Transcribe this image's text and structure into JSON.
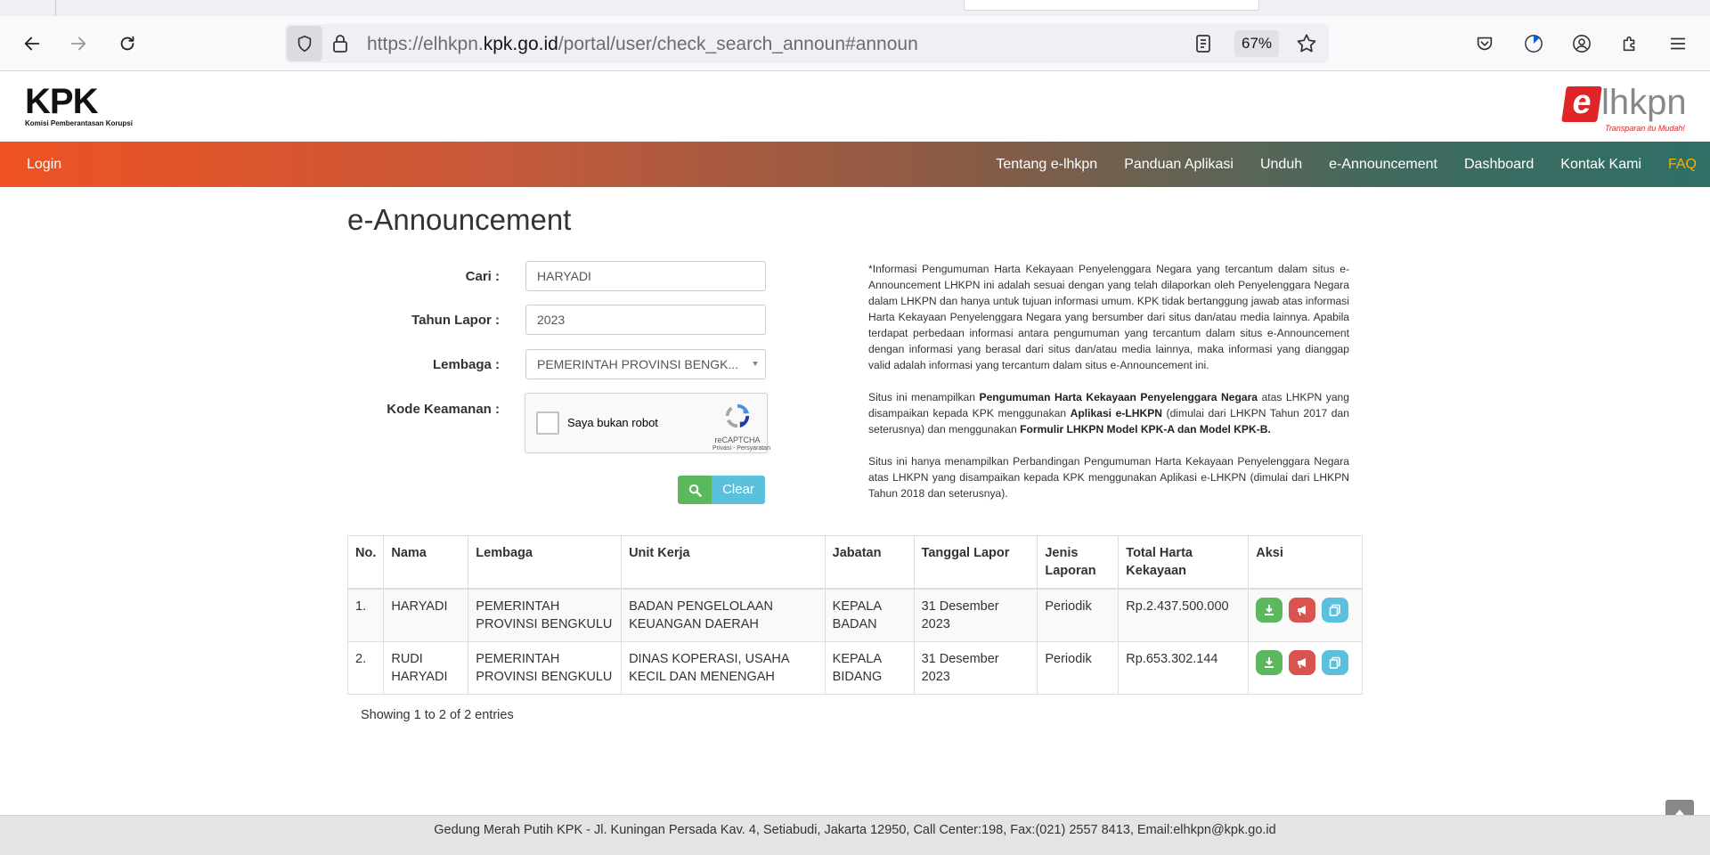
{
  "browser": {
    "url_prefix": "https://elhkpn.",
    "url_domain": "kpk.go.id",
    "url_path": "/portal/user/check_search_announ#announ",
    "zoom": "67%"
  },
  "site": {
    "kpk_logo_text": "KPK",
    "kpk_logo_subtitle": "Komisi Pemberantasan Korupsi",
    "elhkpn_logo_e": "e",
    "elhkpn_logo_rest": "lhkpn",
    "elhkpn_tagline": "Transparan itu Mudah!",
    "login": "Login",
    "menu": [
      "Tentang e-lhkpn",
      "Panduan Aplikasi",
      "Unduh",
      "e-Announcement",
      "Dashboard",
      "Kontak Kami",
      "FAQ"
    ]
  },
  "form": {
    "title": "e-Announcement",
    "cari_label": "Cari :",
    "cari_value": "HARYADI",
    "tahun_label": "Tahun Lapor :",
    "tahun_value": "2023",
    "lembaga_label": "Lembaga :",
    "lembaga_value": "PEMERINTAH PROVINSI BENGK...",
    "kode_label": "Kode Keamanan :",
    "captcha_text": "Saya bukan robot",
    "captcha_brand": "reCAPTCHA",
    "captcha_links": "Privasi - Persyaratan",
    "clear_label": "Clear"
  },
  "info": {
    "p1": "*Informasi Pengumuman Harta Kekayaan Penyelenggara Negara yang tercantum dalam situs e-Announcement LHKPN ini adalah sesuai dengan yang telah dilaporkan oleh Penyelenggara Negara dalam LHKPN dan hanya untuk tujuan informasi umum. KPK tidak bertanggung jawab atas informasi Harta Kekayaan Penyelenggara Negara yang bersumber dari situs dan/atau media lainnya. Apabila terdapat perbedaan informasi antara pengumuman yang tercantum dalam situs e-Announcement dengan informasi yang berasal dari situs dan/atau media lainnya, maka informasi yang dianggap valid adalah informasi yang tercantum dalam situs e-Announcement ini.",
    "p2a": "Situs ini menampilkan ",
    "p2b": "Pengumuman Harta Kekayaan Penyelenggara Negara",
    "p2c": " atas LHKPN yang disampaikan kepada KPK menggunakan ",
    "p2d": "Aplikasi e-LHKPN",
    "p2e": " (dimulai dari LHKPN Tahun 2017 dan seterusnya) dan menggunakan ",
    "p2f": "Formulir LHKPN Model KPK-A dan Model KPK-B.",
    "p3": "Situs ini hanya menampilkan Perbandingan Pengumuman Harta Kekayaan Penyelenggara Negara atas LHKPN yang disampaikan kepada KPK menggunakan Aplikasi e-LHKPN (dimulai dari LHKPN Tahun 2018 dan seterusnya)."
  },
  "table": {
    "headers": [
      "No.",
      "Nama",
      "Lembaga",
      "Unit Kerja",
      "Jabatan",
      "Tanggal Lapor",
      "Jenis Laporan",
      "Total Harta Kekayaan",
      "Aksi"
    ],
    "rows": [
      [
        "1.",
        "HARYADI",
        "PEMERINTAH PROVINSI BENGKULU",
        "BADAN PENGELOLAAN KEUANGAN DAERAH",
        "KEPALA BADAN",
        "31 Desember 2023",
        "Periodik",
        "Rp.2.437.500.000"
      ],
      [
        "2.",
        "RUDI HARYADI",
        "PEMERINTAH PROVINSI BENGKULU",
        "DINAS KOPERASI, USAHA KECIL DAN MENENGAH",
        "KEPALA BIDANG",
        "31 Desember 2023",
        "Periodik",
        "Rp.653.302.144"
      ]
    ],
    "showing": "Showing 1 to 2 of 2 entries"
  },
  "footer": {
    "text": "Gedung Merah Putih KPK - Jl. Kuningan Persada Kav. 4, Setiabudi, Jakarta 12950, Call Center:198, Fax:(021) 2557 8413, Email:elhkpn@kpk.go.id"
  },
  "colors": {
    "menu_start": "#ef5222",
    "menu_end": "#2f6f66",
    "faq": "#f4b400",
    "btn_green": "#5cb85c",
    "btn_red": "#d9534f",
    "btn_info": "#5bc0de"
  }
}
